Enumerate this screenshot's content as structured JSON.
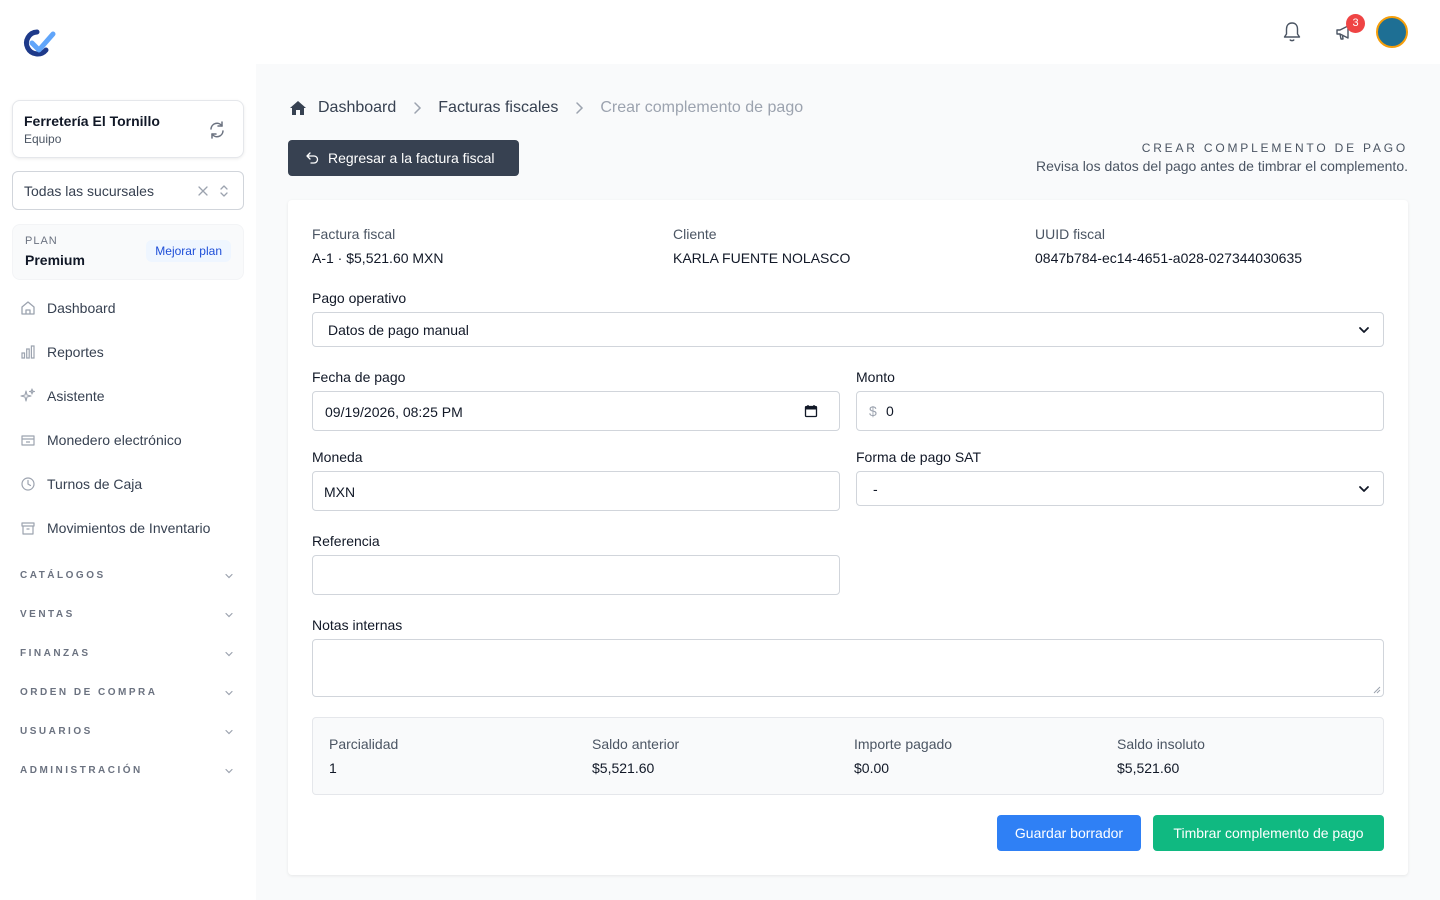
{
  "sidebar": {
    "org_name": "Ferretería El Tornillo",
    "org_sub": "Equipo",
    "branch": "Todas las sucursales",
    "plan_label": "PLAN",
    "plan_name": "Premium",
    "plan_upgrade": "Mejorar plan",
    "nav": [
      "Dashboard",
      "Reportes",
      "Asistente",
      "Monedero electrónico",
      "Turnos de Caja",
      "Movimientos de Inventario"
    ],
    "sections": [
      "CATÁLOGOS",
      "VENTAS",
      "FINANZAS",
      "ORDEN DE COMPRA",
      "USUARIOS",
      "ADMINISTRACIÓN"
    ]
  },
  "topbar": {
    "notification_count": "3"
  },
  "breadcrumb": [
    "Dashboard",
    "Facturas fiscales",
    "Crear complemento de pago"
  ],
  "header": {
    "back_label": "Regresar a la factura fiscal",
    "title": "CREAR COMPLEMENTO DE PAGO",
    "subtitle": "Revisa los datos del pago antes de timbrar el complemento."
  },
  "invoice": {
    "fiscal_label": "Factura fiscal",
    "fiscal_value": "A-1 · $5,521.60 MXN",
    "client_label": "Cliente",
    "client_value": "KARLA FUENTE NOLASCO",
    "uuid_label": "UUID fiscal",
    "uuid_value": "0847b784-ec14-4651-a028-027344030635"
  },
  "form": {
    "operative_label": "Pago operativo",
    "operative_value": "Datos de pago manual",
    "date_label": "Fecha de pago",
    "date_value": "09/19/2026, 08:25 PM",
    "amount_label": "Monto",
    "amount_prefix": "$",
    "amount_value": "0",
    "currency_label": "Moneda",
    "currency_value": "MXN",
    "sat_label": "Forma de pago SAT",
    "sat_value": "-",
    "reference_label": "Referencia",
    "reference_value": "",
    "notes_label": "Notas internas",
    "notes_value": ""
  },
  "summary": [
    {
      "label": "Parcialidad",
      "value": "1"
    },
    {
      "label": "Saldo anterior",
      "value": "$5,521.60"
    },
    {
      "label": "Importe pagado",
      "value": "$0.00"
    },
    {
      "label": "Saldo insoluto",
      "value": "$5,521.60"
    }
  ],
  "actions": {
    "draft": "Guardar borrador",
    "stamp": "Timbrar complemento de pago"
  },
  "colors": {
    "primary_dark": "#374151",
    "blue": "#2f80f5",
    "green": "#10b981",
    "badge_red": "#ef4444"
  }
}
